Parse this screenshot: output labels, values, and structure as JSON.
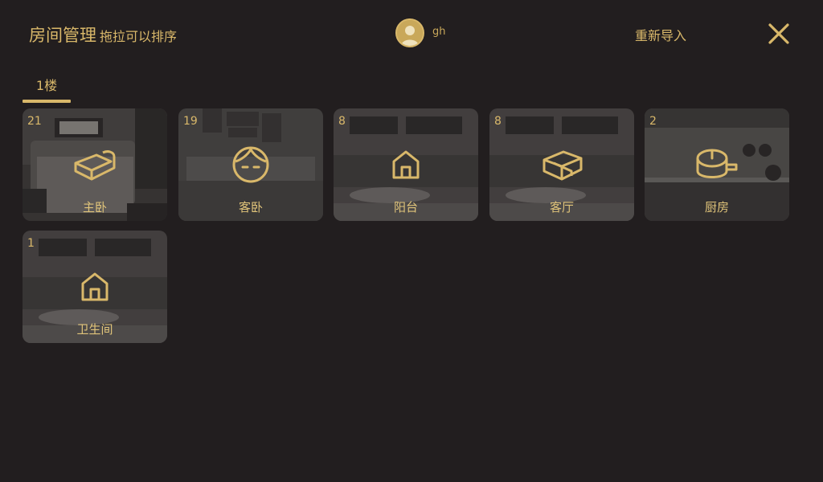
{
  "header": {
    "title": "房间管理",
    "subtitle": "拖拉可以排序",
    "username": "gh",
    "reimport_label": "重新导入"
  },
  "colors": {
    "accent": "#d9b86a",
    "background": "#221e1f"
  },
  "tabs": [
    {
      "label": "1楼",
      "active": true
    }
  ],
  "rooms": [
    {
      "count": "21",
      "name": "主卧",
      "icon": "bed-icon",
      "scene": "bedroom"
    },
    {
      "count": "19",
      "name": "客卧",
      "icon": "face-icon",
      "scene": "guestroom"
    },
    {
      "count": "8",
      "name": "阳台",
      "icon": "house-icon",
      "scene": "living"
    },
    {
      "count": "8",
      "name": "客厅",
      "icon": "sofa-icon",
      "scene": "living"
    },
    {
      "count": "2",
      "name": "厨房",
      "icon": "pot-icon",
      "scene": "kitchen"
    },
    {
      "count": "1",
      "name": "卫生间",
      "icon": "house-icon",
      "scene": "living"
    }
  ]
}
